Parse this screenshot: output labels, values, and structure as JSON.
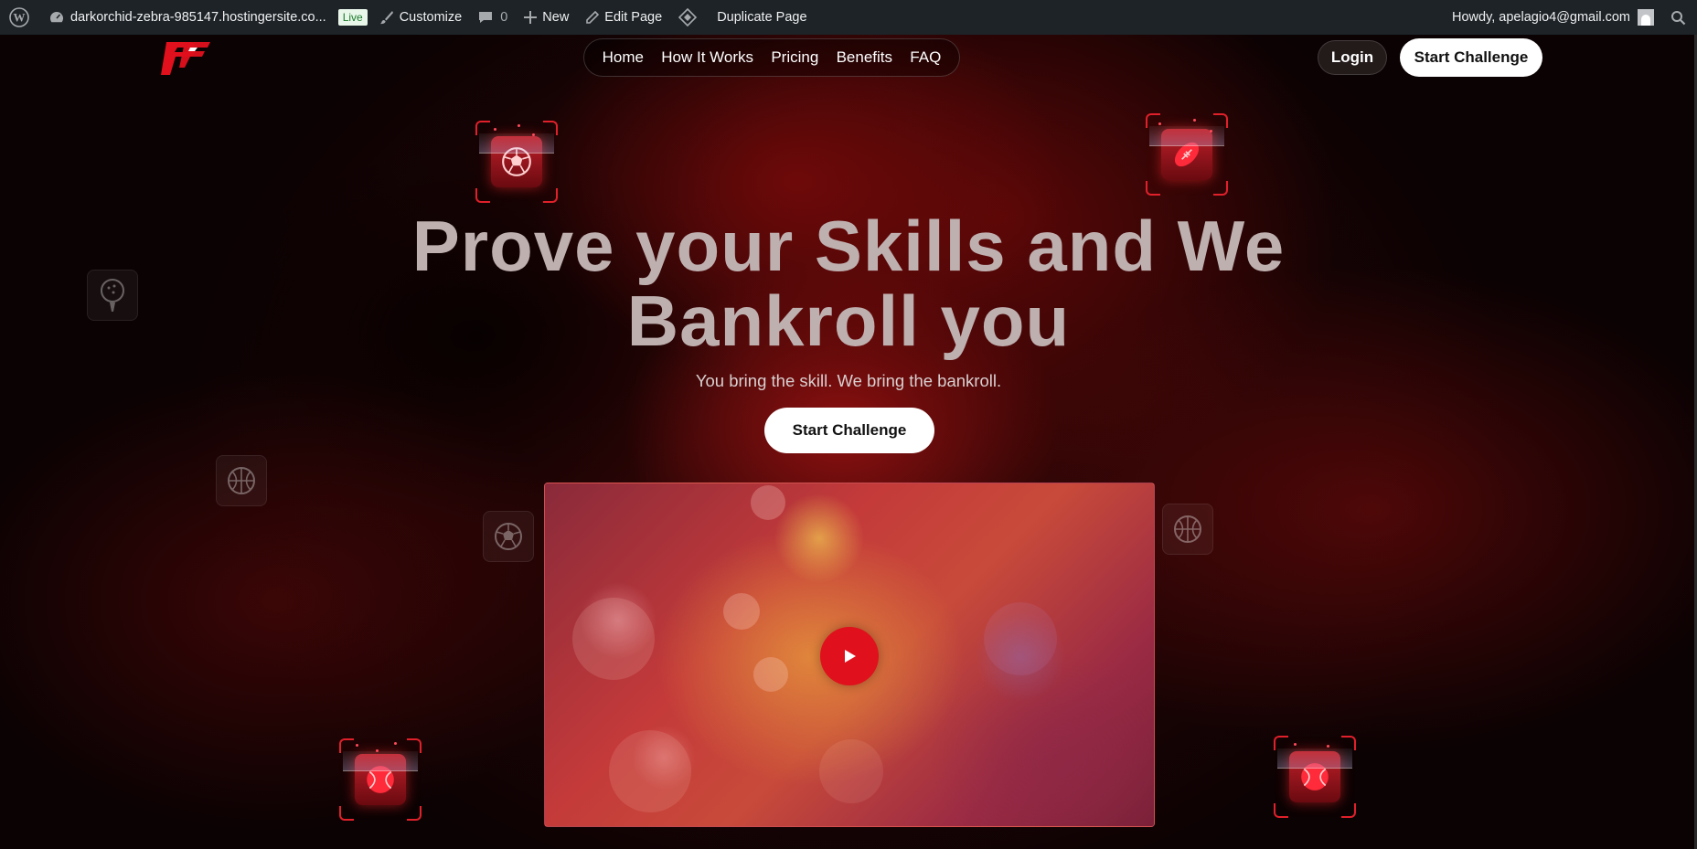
{
  "adminbar": {
    "site_name": "darkorchid-zebra-985147.hostingersite.co...",
    "live_badge": "Live",
    "customize": "Customize",
    "comments_count": "0",
    "new": "New",
    "edit_page": "Edit Page",
    "duplicate_page": "Duplicate Page",
    "howdy": "Howdy, apelagio4@gmail.com"
  },
  "nav": {
    "items": [
      "Home",
      "How It Works",
      "Pricing",
      "Benefits",
      "FAQ"
    ],
    "login": "Login",
    "cta": "Start Challenge"
  },
  "hero": {
    "headline_line1": "Prove your Skills and We",
    "headline_line2": "Bankroll you",
    "subheadline": "You bring the skill. We bring the bankroll.",
    "cta": "Start Challenge"
  },
  "video": {
    "play_icon": "play-icon"
  },
  "decor_icons": [
    "soccer-ball-icon",
    "football-icon",
    "golf-ball-icon",
    "basketball-icon",
    "baseball-icon"
  ],
  "colors": {
    "accent_red": "#e0101c",
    "admin_bar": "#1d2327",
    "background": "#0a0203"
  }
}
